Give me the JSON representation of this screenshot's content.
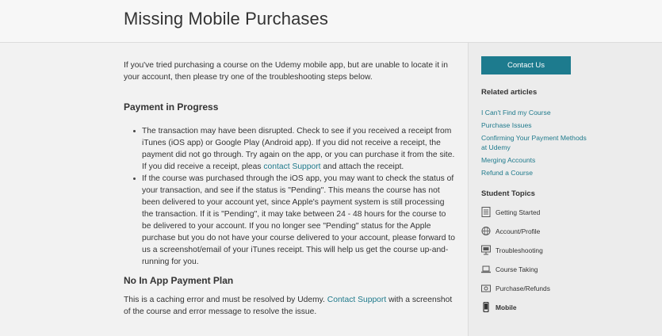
{
  "header": {
    "title": "Missing Mobile Purchases"
  },
  "main": {
    "intro": "If you've tried purchasing a course on the Udemy mobile app, but are unable to locate it in your account, then please try one of the troubleshooting steps below.",
    "section1": {
      "heading": "Payment in Progress",
      "bullet1_pre": "The transaction may have been disrupted. Check to see if you received a receipt from iTunes (iOS app) or Google Play (Android app). If you did not receive a receipt, the payment did not go through. Try again on the app, or you can purchase it from the site. If you did receive a receipt, pleas ",
      "bullet1_link": "contact Support",
      "bullet1_post": " and attach the receipt.",
      "bullet2": "If the course was purchased through the iOS app, you may want to check the status of your transaction, and see if the status is \"Pending\". This means the course has not been delivered to your account yet, since Apple's payment system is still processing the transaction. If it is \"Pending\", it may take between 24 - 48 hours for the course to be delivered to your account. If you no longer see \"Pending\" status for the Apple purchase but you do not have your course delivered to your account, please forward to us a screenshot/email of your iTunes receipt. This will help us get the course up-and-running for you."
    },
    "section2": {
      "heading": "No In App Payment Plan",
      "text_pre": "This is a caching error and must be resolved by Udemy. ",
      "text_link": "Contact Support",
      "text_post": " with a screenshot of the course and error message to resolve the issue."
    }
  },
  "sidebar": {
    "contact_button": "Contact Us",
    "related_heading": "Related articles",
    "related": [
      "I Can't Find my Course",
      "Purchase Issues",
      "Confirming Your Payment Methods at Udemy",
      "Merging Accounts",
      "Refund a Course"
    ],
    "topics_heading": "Student Topics",
    "topics": [
      {
        "label": "Getting Started",
        "icon": "checklist-icon"
      },
      {
        "label": "Account/Profile",
        "icon": "globe-icon"
      },
      {
        "label": "Troubleshooting",
        "icon": "monitor-icon"
      },
      {
        "label": "Course Taking",
        "icon": "laptop-icon"
      },
      {
        "label": "Purchase/Refunds",
        "icon": "payment-card-icon"
      },
      {
        "label": "Mobile",
        "icon": "mobile-phone-icon"
      }
    ]
  },
  "colors": {
    "accent": "#1d7b8e",
    "link": "#1f7a8c"
  }
}
